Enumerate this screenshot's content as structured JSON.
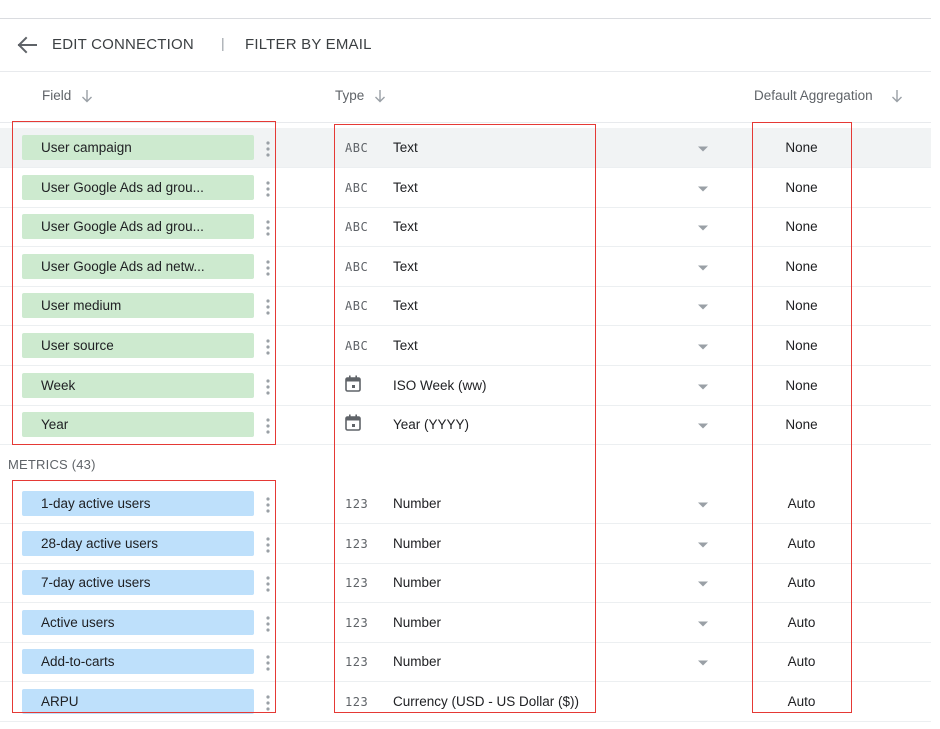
{
  "toolbar": {
    "edit_connection_label": "EDIT CONNECTION",
    "separator": "|",
    "filter_label": "FILTER BY EMAIL"
  },
  "columns": {
    "field": "Field",
    "type": "Type",
    "aggregation": "Default Aggregation"
  },
  "dimensions": [
    {
      "name": "User campaign",
      "type_icon": "ABC",
      "type": "Text",
      "aggregation": "None"
    },
    {
      "name": "User Google Ads ad grou...",
      "type_icon": "ABC",
      "type": "Text",
      "aggregation": "None"
    },
    {
      "name": "User Google Ads ad grou...",
      "type_icon": "ABC",
      "type": "Text",
      "aggregation": "None"
    },
    {
      "name": "User Google Ads ad netw...",
      "type_icon": "ABC",
      "type": "Text",
      "aggregation": "None"
    },
    {
      "name": "User medium",
      "type_icon": "ABC",
      "type": "Text",
      "aggregation": "None"
    },
    {
      "name": "User source",
      "type_icon": "ABC",
      "type": "Text",
      "aggregation": "None"
    },
    {
      "name": "Week",
      "type_icon": "calendar-icon",
      "type": "ISO Week (ww)",
      "aggregation": "None"
    },
    {
      "name": "Year",
      "type_icon": "calendar-icon",
      "type": "Year (YYYY)",
      "aggregation": "None"
    }
  ],
  "metrics_section_label": "METRICS (43)",
  "metrics": [
    {
      "name": "1-day active users",
      "type_icon": "123",
      "type": "Number",
      "aggregation": "Auto"
    },
    {
      "name": "28-day active users",
      "type_icon": "123",
      "type": "Number",
      "aggregation": "Auto"
    },
    {
      "name": "7-day active users",
      "type_icon": "123",
      "type": "Number",
      "aggregation": "Auto"
    },
    {
      "name": "Active users",
      "type_icon": "123",
      "type": "Number",
      "aggregation": "Auto"
    },
    {
      "name": "Add-to-carts",
      "type_icon": "123",
      "type": "Number",
      "aggregation": "Auto"
    },
    {
      "name": "ARPU",
      "type_icon": "123",
      "type": "Currency (USD - US Dollar ($))",
      "aggregation": "Auto"
    }
  ],
  "colors": {
    "dimension_chip": "#cdeacf",
    "metric_chip": "#bee0fb",
    "highlight_box": "#e53935"
  }
}
